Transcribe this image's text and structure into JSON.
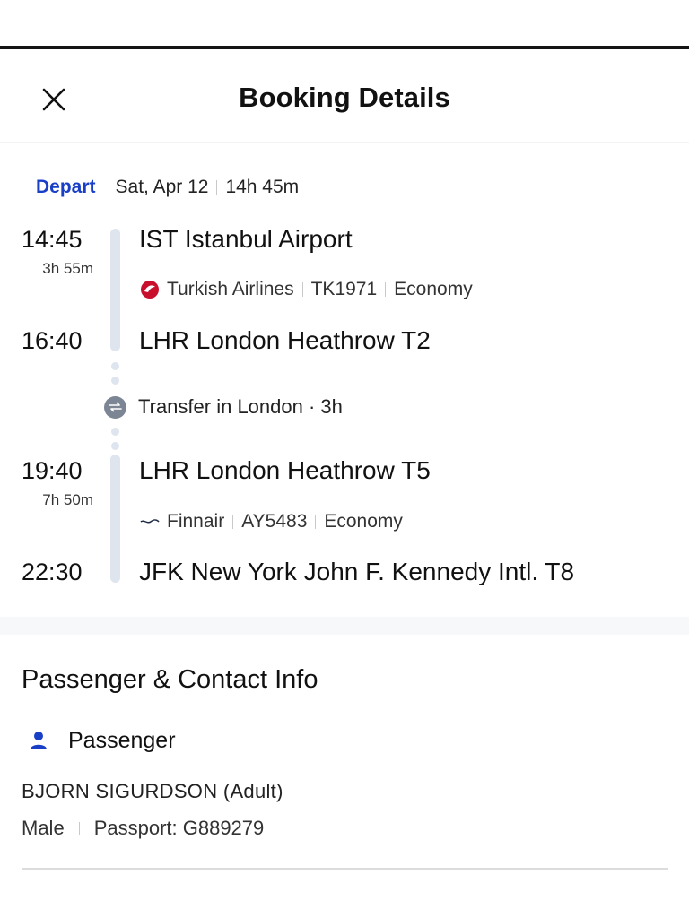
{
  "header": {
    "title": "Booking Details",
    "close_icon": "close-icon"
  },
  "depart": {
    "tag": "Depart",
    "date": "Sat, Apr 12",
    "total_duration": "14h 45m",
    "tag_color": "#1a3fc7"
  },
  "segments": [
    {
      "dep_time": "14:45",
      "duration": "3h 55m",
      "dep_airport": "IST Istanbul Airport",
      "airline": "Turkish Airlines",
      "airline_icon": "turkish-airlines-logo-icon",
      "flight_no": "TK1971",
      "cabin": "Economy",
      "arr_time": "16:40",
      "arr_airport": "LHR London Heathrow T2"
    },
    {
      "dep_time": "19:40",
      "duration": "7h 50m",
      "dep_airport": "LHR London Heathrow T5",
      "airline": "Finnair",
      "airline_icon": "finnair-logo-icon",
      "flight_no": "AY5483",
      "cabin": "Economy",
      "arr_time": "22:30",
      "arr_airport": "JFK New York John F. Kennedy Intl. T8"
    }
  ],
  "transfer": {
    "text": "Transfer in London · 3h",
    "icon": "transfer-icon"
  },
  "passenger_section": {
    "title": "Passenger & Contact Info",
    "passenger_label": "Passenger",
    "passenger_icon": "person-icon",
    "name": "BJORN SIGURDSON (Adult)",
    "gender": "Male",
    "passport": "Passport: G889279"
  },
  "colors": {
    "accent": "#1a3fc7",
    "track": "#dfe5ee",
    "turkish_red": "#c8102e"
  }
}
